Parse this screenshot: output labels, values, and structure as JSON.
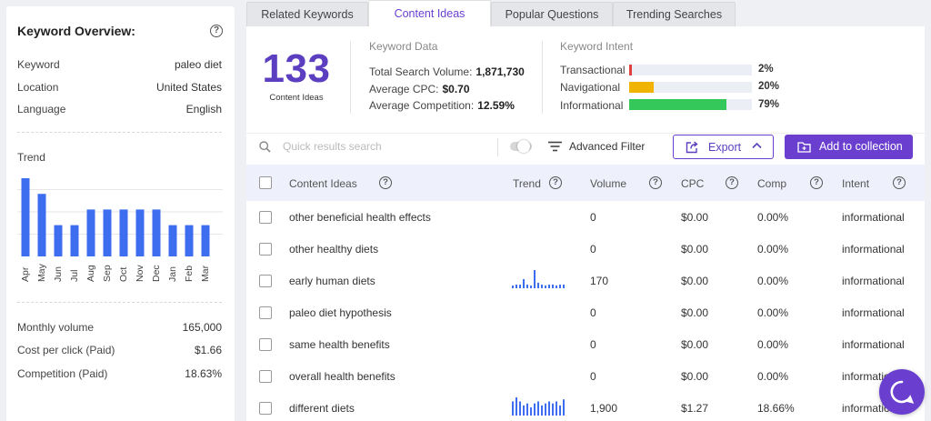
{
  "overview": {
    "title": "Keyword Overview:",
    "help": "?",
    "rows": [
      {
        "label": "Keyword",
        "value": "paleo diet"
      },
      {
        "label": "Location",
        "value": "United States"
      },
      {
        "label": "Language",
        "value": "English"
      }
    ],
    "trend_label": "Trend",
    "stats": [
      {
        "label": "Monthly volume",
        "value": "165,000"
      },
      {
        "label": "Cost per click (Paid)",
        "value": "$1.66"
      },
      {
        "label": "Competition (Paid)",
        "value": "18.63%"
      }
    ]
  },
  "chart_data": {
    "type": "bar",
    "categories": [
      "Apr",
      "May",
      "Jun",
      "Jul",
      "Aug",
      "Sep",
      "Oct",
      "Nov",
      "Dec",
      "Jan",
      "Feb",
      "Mar"
    ],
    "values": [
      100,
      80,
      40,
      40,
      60,
      60,
      60,
      60,
      60,
      40,
      40,
      40
    ],
    "title": "Trend",
    "ylim": [
      0,
      100
    ],
    "grid": true,
    "color": "#3e6ef0"
  },
  "tabs": [
    "Related Keywords",
    "Content Ideas",
    "Popular Questions",
    "Trending Searches"
  ],
  "summary": {
    "count": "133",
    "count_label": "Content Ideas",
    "keyword_data_title": "Keyword Data",
    "keyword_data": [
      {
        "label": "Total Search Volume:",
        "value": "1,871,730"
      },
      {
        "label": "Average CPC:",
        "value": "$0.70"
      },
      {
        "label": "Average Competition:",
        "value": "12.59%"
      }
    ],
    "intent_title": "Keyword Intent",
    "intents": [
      {
        "label": "Transactional",
        "pct": "2%",
        "fraction": 0.02,
        "color": "#e04040"
      },
      {
        "label": "Navigational",
        "pct": "20%",
        "fraction": 0.2,
        "color": "#f0b400"
      },
      {
        "label": "Informational",
        "pct": "79%",
        "fraction": 0.79,
        "color": "#34c759"
      }
    ]
  },
  "toolbar": {
    "search_placeholder": "Quick results search",
    "filter_label": "Advanced Filter",
    "export_label": "Export",
    "collection_label": "Add to collection"
  },
  "table": {
    "headers": {
      "idea": "Content Ideas",
      "trend": "Trend",
      "volume": "Volume",
      "cpc": "CPC",
      "comp": "Comp",
      "intent": "Intent"
    },
    "rows": [
      {
        "idea": "other beneficial health effects",
        "volume": "0",
        "cpc": "$0.00",
        "comp": "0.00%",
        "intent": "informational",
        "trend": []
      },
      {
        "idea": "other healthy diets",
        "volume": "0",
        "cpc": "$0.00",
        "comp": "0.00%",
        "intent": "informational",
        "trend": []
      },
      {
        "idea": "early human diets",
        "volume": "170",
        "cpc": "$0.00",
        "comp": "0.00%",
        "intent": "informational",
        "trend": [
          3,
          4,
          4,
          10,
          4,
          3,
          20,
          6,
          4,
          3,
          4,
          4,
          3,
          4,
          4
        ]
      },
      {
        "idea": "paleo diet hypothesis",
        "volume": "0",
        "cpc": "$0.00",
        "comp": "0.00%",
        "intent": "informational",
        "trend": []
      },
      {
        "idea": "same health benefits",
        "volume": "0",
        "cpc": "$0.00",
        "comp": "0.00%",
        "intent": "informational",
        "trend": []
      },
      {
        "idea": "overall health benefits",
        "volume": "0",
        "cpc": "$0.00",
        "comp": "0.00%",
        "intent": "informational",
        "trend": []
      },
      {
        "idea": "different diets",
        "volume": "1,900",
        "cpc": "$1.27",
        "comp": "18.66%",
        "intent": "informational",
        "trend": [
          14,
          18,
          14,
          10,
          12,
          8,
          12,
          14,
          10,
          12,
          14,
          12,
          14,
          10,
          16
        ]
      }
    ]
  },
  "accent_color": "#6a3fd0"
}
